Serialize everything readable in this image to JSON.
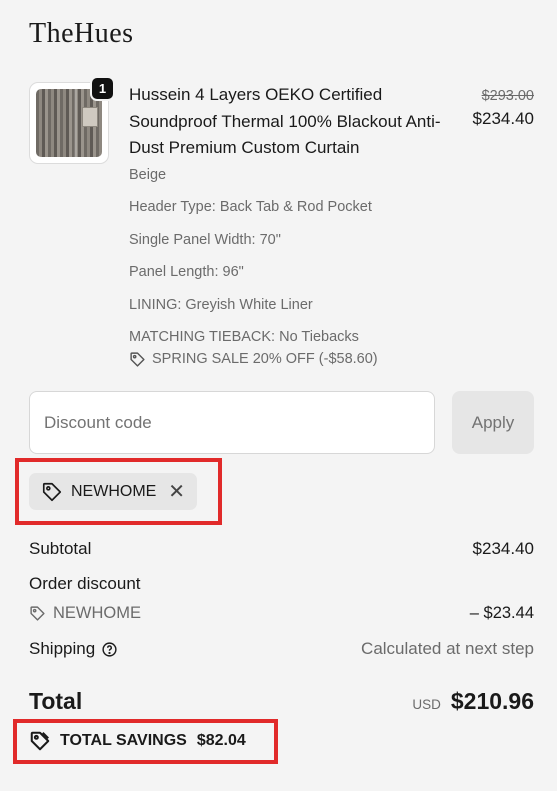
{
  "brand": "TheHues",
  "product": {
    "quantity": "1",
    "title": "Hussein 4 Layers OEKO Certified Soundproof Thermal 100% Blackout Anti-Dust Premium Custom Curtain",
    "color": "Beige",
    "options": [
      "Header Type: Back Tab & Rod Pocket",
      "Single Panel Width: 70\"",
      "Panel Length: 96\"",
      "LINING: Greyish White Liner",
      "MATCHING TIEBACK: No Tiebacks"
    ],
    "promo": "SPRING SALE 20% OFF (-$58.60)",
    "original_price": "$293.00",
    "price": "$234.40",
    "image_icon": "curtain-product-image"
  },
  "discount": {
    "placeholder": "Discount code",
    "value": "",
    "apply_label": "Apply",
    "applied_code": "NEWHOME"
  },
  "summary": {
    "subtotal_label": "Subtotal",
    "subtotal_value": "$234.40",
    "order_discount_label": "Order discount",
    "discount_code": "NEWHOME",
    "discount_value": "– $23.44",
    "shipping_label": "Shipping",
    "shipping_value": "Calculated at next step",
    "total_label": "Total",
    "currency": "USD",
    "total_value": "$210.96",
    "savings_label": "TOTAL SAVINGS",
    "savings_value": "$82.04"
  },
  "colors": {
    "background": "#f4f4f4",
    "highlight": "#e12a2a",
    "chip": "#e6e6e6",
    "text": "#1a1a1a",
    "muted": "#6b6b6b"
  }
}
